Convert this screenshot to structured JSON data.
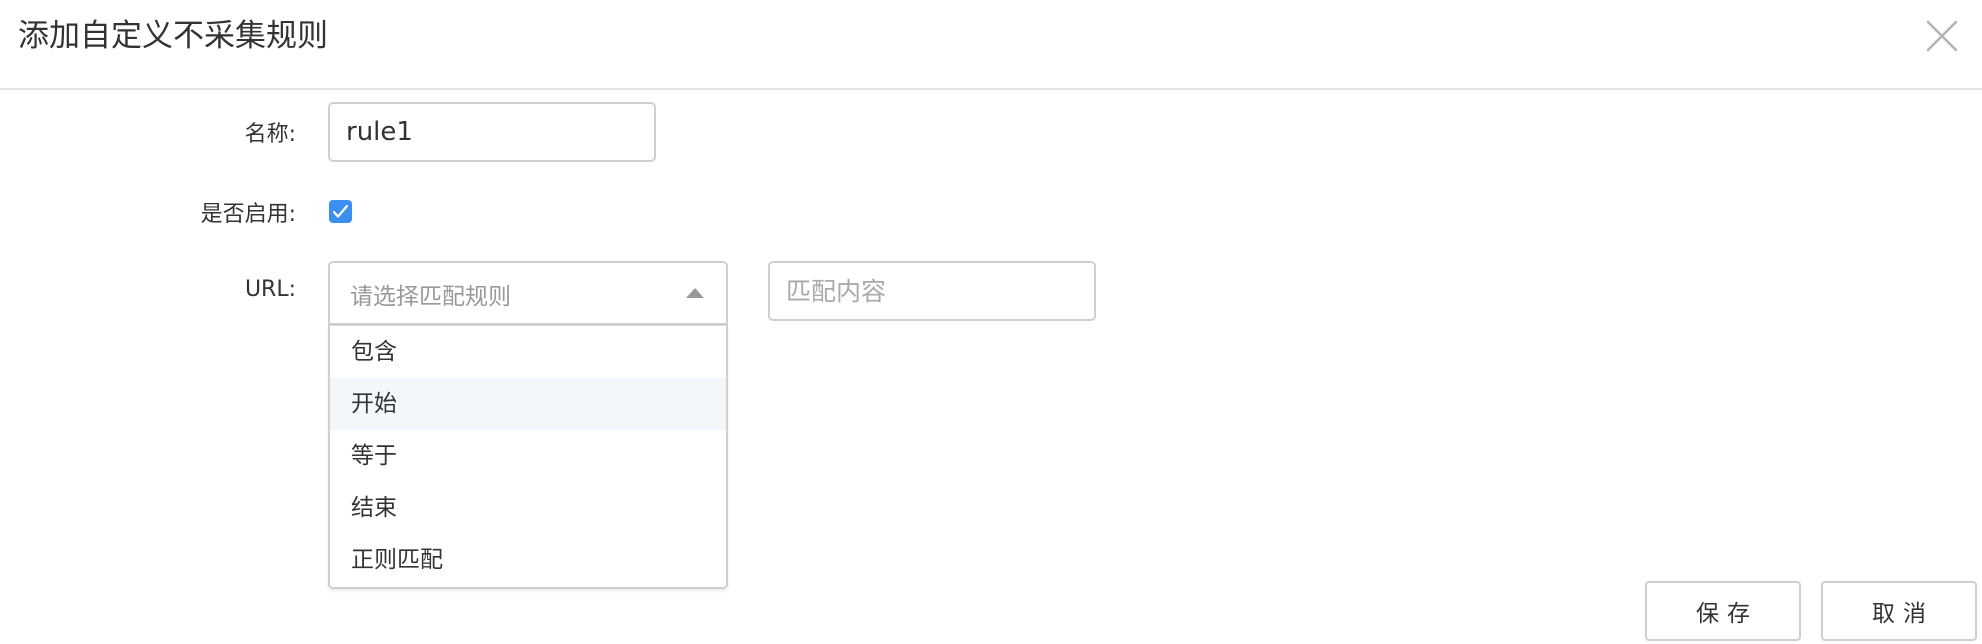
{
  "dialog": {
    "title": "添加自定义不采集规则"
  },
  "form": {
    "name_label": "名称:",
    "name_value": "rule1",
    "enabled_label": "是否启用:",
    "enabled": true,
    "url_label": "URL:",
    "match_rule_placeholder": "请选择匹配规则",
    "match_content_placeholder": "匹配内容"
  },
  "dropdown": {
    "options": [
      {
        "label": "包含"
      },
      {
        "label": "开始",
        "highlighted": true
      },
      {
        "label": "等于"
      },
      {
        "label": "结束"
      },
      {
        "label": "正则匹配"
      }
    ]
  },
  "actions": {
    "save_label": "保存",
    "cancel_label": "取消"
  },
  "icons": {
    "close": "close-icon",
    "checkbox": "checkmark-icon",
    "select_arrow": "caret-up-icon"
  },
  "colors": {
    "accent": "#3b8ff0",
    "option_highlight": "#f1f7fb",
    "border": "#cfcfcf"
  }
}
